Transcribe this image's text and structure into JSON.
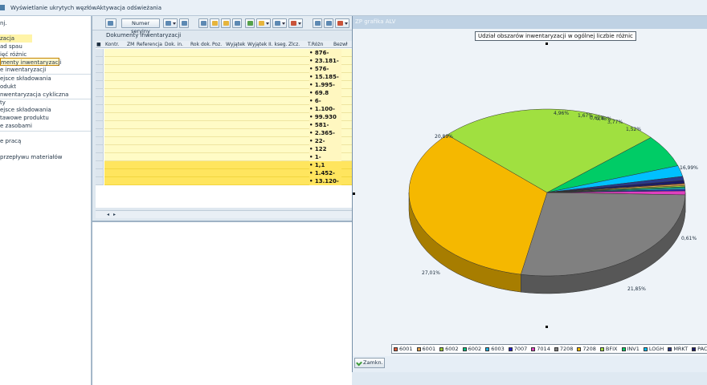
{
  "topbar": {
    "items": [
      "Wyświetlanie ukrytych węzłów",
      "Aktywacja odświeżania"
    ]
  },
  "nav": {
    "items": [
      "nj.",
      "zacja",
      "ad spau",
      "ięć różnic",
      "menty inwentaryzacji",
      "e inwentaryzacji",
      "ejsce składowania",
      "odukt",
      "nwentaryzacja cykliczna",
      "ty",
      "ejsce składowania",
      "tawowe produktu",
      "e zasobami",
      "e pracą",
      "przepływu materiałów"
    ]
  },
  "table": {
    "toolbar": {
      "number_button": "Numer seryjny"
    },
    "title": "Dokumenty inwentaryzacji",
    "columns": [
      "Kontr.",
      "ZM",
      "Referencja",
      "Dok. in.",
      "Rok dok.",
      "Poz.",
      "Wyjątek",
      "Wyjątek II. kseg.",
      "Zlcz.",
      "T.Różn",
      "Bezwł"
    ],
    "values": [
      "876-",
      "23.181-",
      "576-",
      "15.185-",
      "1.995-",
      "69.8",
      "6-",
      "1.100-",
      "99.930",
      "581-",
      "2.365-",
      "22-",
      "122",
      "1-",
      "1,1",
      "1.452-",
      "13.120-"
    ]
  },
  "chart_window": {
    "title": "ZP grafika ALV",
    "close_button": "Zamkn.",
    "accent": "#bfd2e4"
  },
  "chart_data": {
    "type": "pie",
    "title": "Udział obszarów inwentaryzacji w ogólnej liczbie różnic",
    "labels": [
      "6001",
      "6001",
      "6002",
      "6002",
      "6003",
      "7007",
      "7014",
      "7208",
      "7208",
      "BFIX",
      "INV1",
      "LOGH",
      "MRKT",
      "PACK"
    ],
    "values": [
      0.1,
      0.25,
      0.2,
      0.2,
      0.2,
      0.2,
      0.61,
      21.85,
      27.01,
      20.89,
      4.96,
      1.67,
      0.62,
      0.43
    ],
    "percent_labels": [
      "0,61%",
      "21,85%",
      "27,01%",
      "20,89%",
      "4,96%",
      "1,67%",
      "0,62%",
      "0,43%",
      "3,77%",
      "1,52%",
      "16,99%"
    ],
    "colors": [
      "#e05a3a",
      "#e0a050",
      "#9acd32",
      "#00c080",
      "#20b0e0",
      "#2020c8",
      "#e040c0",
      "#808080",
      "#f5b800",
      "#a0e040",
      "#00cc66",
      "#00c0ff",
      "#2a3a8a",
      "#1a1a6a"
    ],
    "legend": "bottom"
  }
}
